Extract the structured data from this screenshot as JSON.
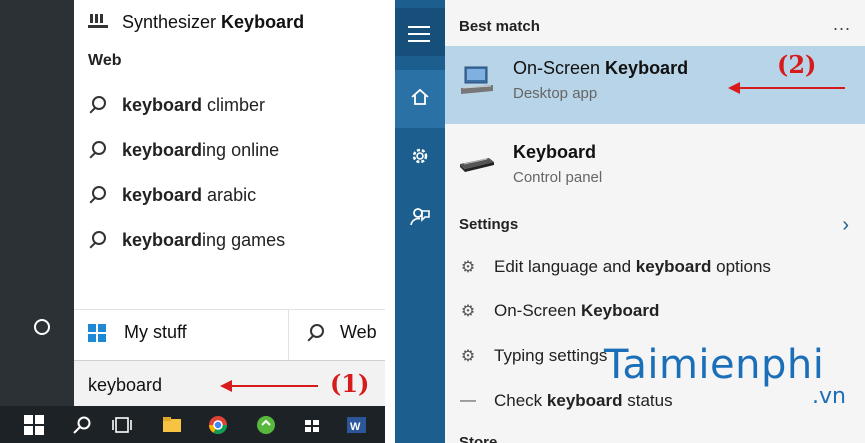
{
  "left_panel": {
    "top_item": {
      "prefix": "Synthesizer ",
      "bold": "Keyboard",
      "icon": "keyboard-icon"
    },
    "web_header": "Web",
    "suggestions": [
      {
        "bold": "keyboard",
        "rest": " climber"
      },
      {
        "bold": "keyboard",
        "rest": "ing online"
      },
      {
        "bold": "keyboard",
        "rest": " arabic"
      },
      {
        "bold": "keyboard",
        "rest": "ing games"
      }
    ],
    "my_stuff": "My stuff",
    "web_button": "Web",
    "search_query": "keyboard",
    "annotation": "(1)"
  },
  "right_panel": {
    "best_match_label": "Best match",
    "more_label": "...",
    "best_match": {
      "title_prefix": "On-Screen ",
      "title_bold": "Keyboard",
      "subtitle": "Desktop app"
    },
    "second_match": {
      "title": "Keyboard",
      "subtitle": "Control panel"
    },
    "settings_label": "Settings",
    "settings_items": [
      {
        "prefix": "Edit language and ",
        "bold": "keyboard",
        "suffix": " options",
        "icon": "gear-icon"
      },
      {
        "prefix": "On-Screen ",
        "bold": "Keyboard",
        "suffix": "",
        "icon": "gear-icon"
      },
      {
        "prefix": "Typing settings",
        "bold": "",
        "suffix": "",
        "icon": "gear-icon"
      },
      {
        "prefix": "Check ",
        "bold": "keyboard",
        "suffix": " status",
        "icon": "pen-icon"
      }
    ],
    "store_label": "Store",
    "annotation": "(2)"
  },
  "watermark": {
    "main": "Taimienphi",
    "suffix": ".vn"
  },
  "colors": {
    "rail_left": "#2b3135",
    "rail_right": "#1c5e8e",
    "highlight": "#b8d4e8",
    "annotation": "#d71a1a",
    "watermark": "#1b6fb8"
  }
}
